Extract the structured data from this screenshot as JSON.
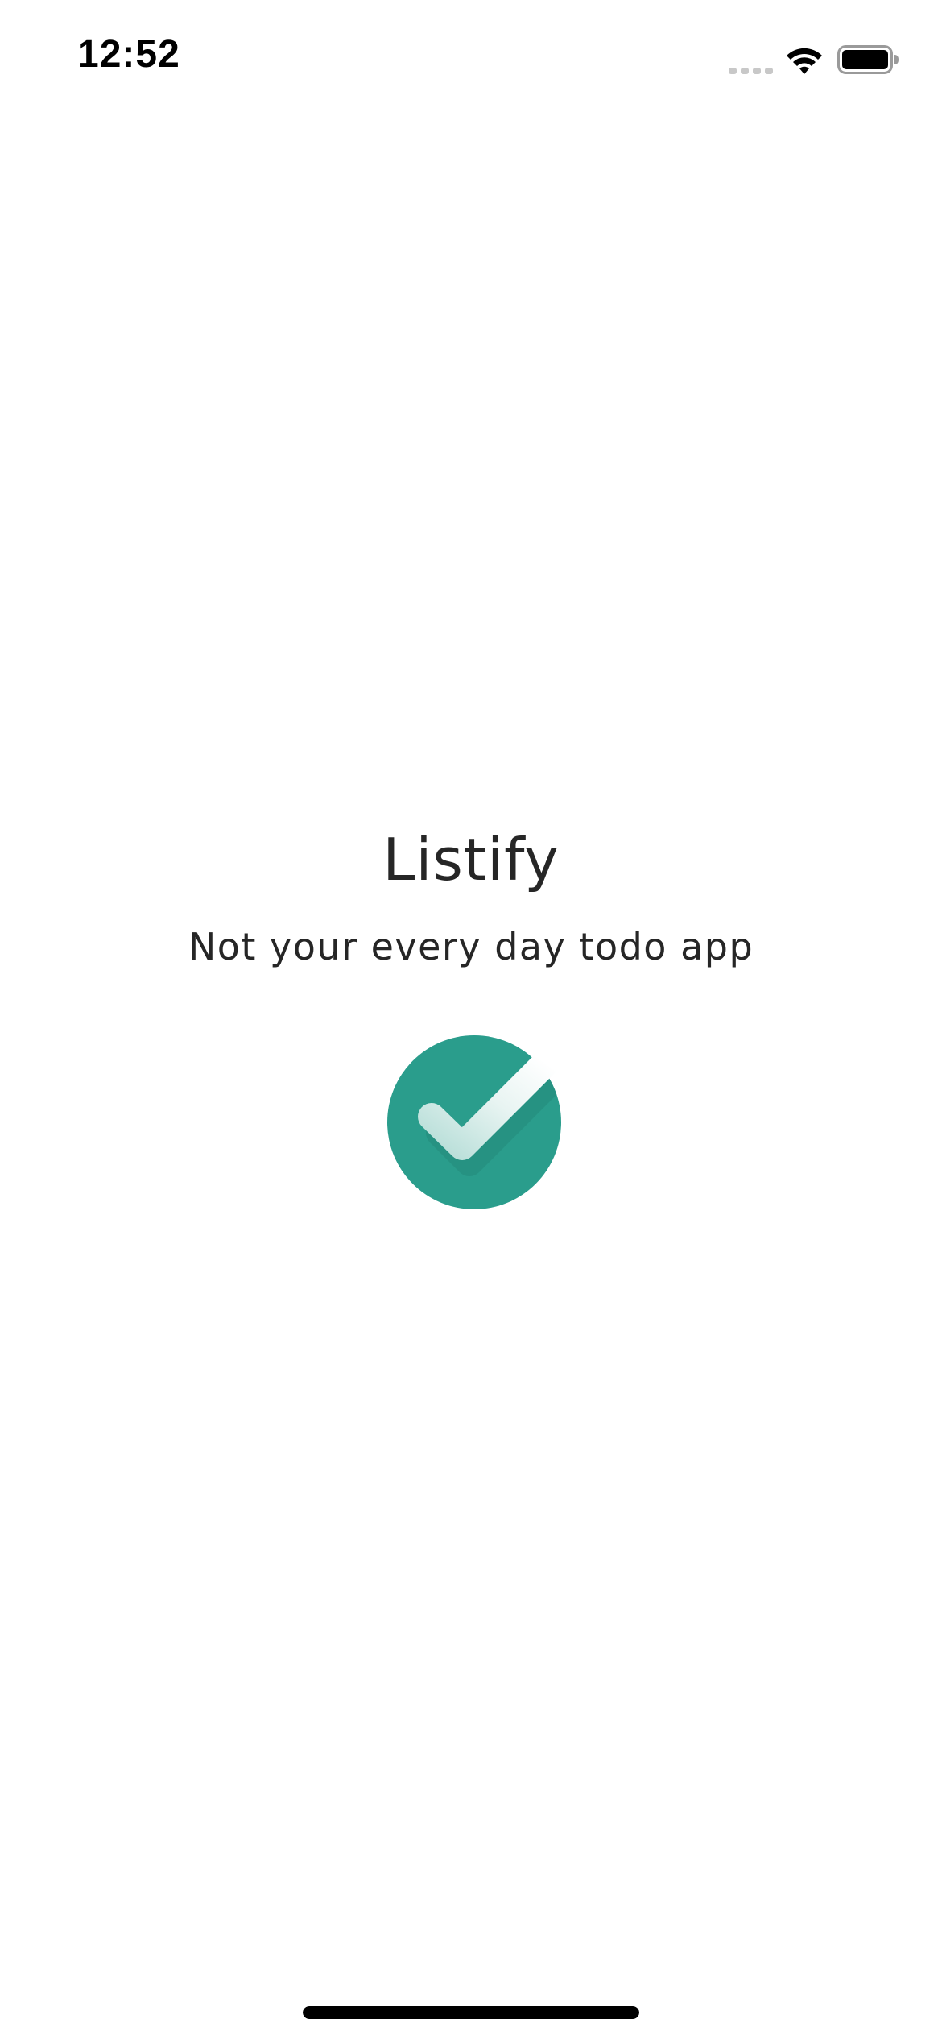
{
  "status_bar": {
    "time": "12:52",
    "signal_icon": "cellular-signal-icon",
    "wifi_icon": "wifi-icon",
    "battery_icon": "battery-icon"
  },
  "splash": {
    "title": "Listify",
    "tagline": "Not your every day todo app",
    "logo_icon": "checkmark-circle-icon"
  },
  "colors": {
    "brand_teal": "#2a9d8c",
    "text": "#262626",
    "background": "#ffffff",
    "home_indicator": "#000000"
  }
}
